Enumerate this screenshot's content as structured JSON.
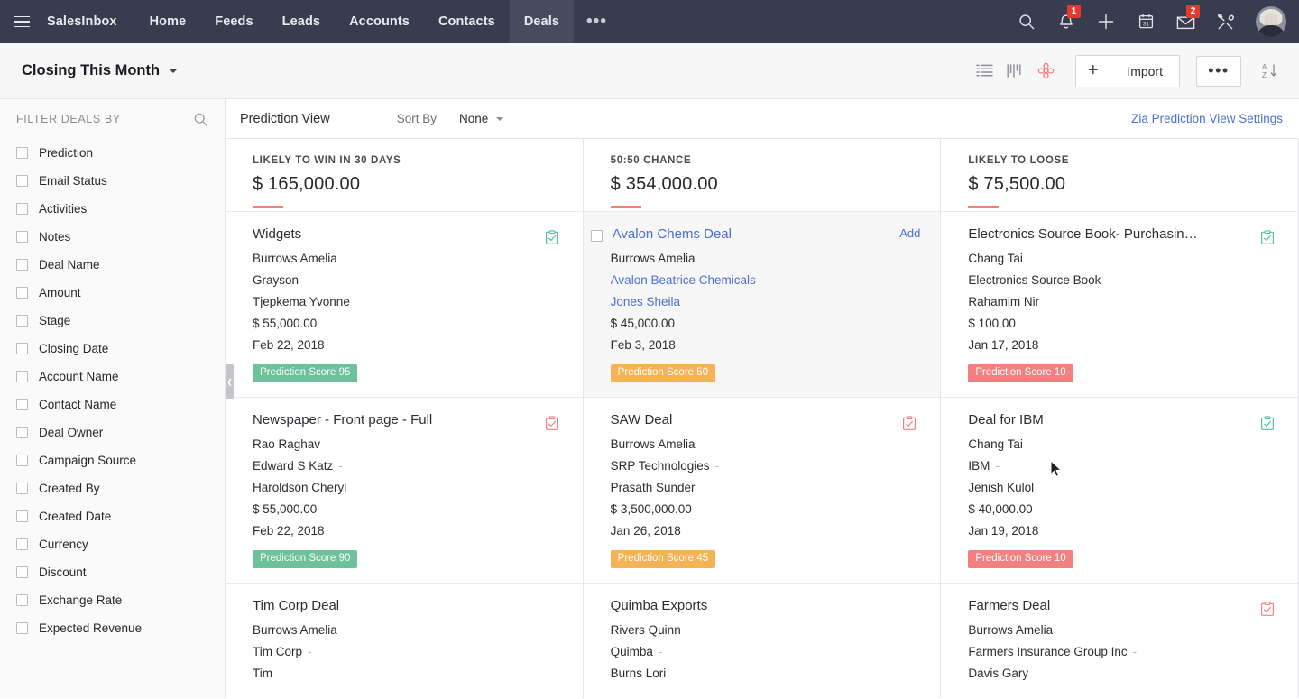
{
  "topnav": {
    "menu_icon": "hamburger-icon",
    "tabs": [
      {
        "label": "SalesInbox",
        "active": false
      },
      {
        "label": "Home",
        "active": false
      },
      {
        "label": "Feeds",
        "active": false
      },
      {
        "label": "Leads",
        "active": false
      },
      {
        "label": "Accounts",
        "active": false
      },
      {
        "label": "Contacts",
        "active": false
      },
      {
        "label": "Deals",
        "active": true
      }
    ],
    "more_label": "•••",
    "icons": [
      {
        "name": "search-icon",
        "badge": ""
      },
      {
        "name": "notifications-bell-icon",
        "badge": "1"
      },
      {
        "name": "add-plus-icon",
        "badge": ""
      },
      {
        "name": "calendar-icon",
        "badge": "",
        "day": "31"
      },
      {
        "name": "mail-envelope-icon",
        "badge": "2"
      },
      {
        "name": "setup-tools-icon",
        "badge": ""
      }
    ],
    "avatar_name": "user-avatar",
    "background": "#383c4e",
    "active_tab_background": "#474b5e",
    "badge_color": "#e13b2f"
  },
  "toolbar": {
    "view_name": "Closing This Month",
    "list_view_icon": "list-view-icon",
    "kanban_view_icon": "kanban-view-icon",
    "zia_icon": "zia-flower-icon",
    "add_label": "+",
    "import_label": "Import",
    "more_label": "•••",
    "sort_icon": "sort-az-descending-icon"
  },
  "sidebar": {
    "title": "FILTER DEALS BY",
    "search_icon": "search-icon",
    "items": [
      {
        "label": "Prediction",
        "checked": false
      },
      {
        "label": "Email Status",
        "checked": false
      },
      {
        "label": "Activities",
        "checked": false
      },
      {
        "label": "Notes",
        "checked": false
      },
      {
        "label": "Deal Name",
        "checked": false
      },
      {
        "label": "Amount",
        "checked": false
      },
      {
        "label": "Stage",
        "checked": false
      },
      {
        "label": "Closing Date",
        "checked": false
      },
      {
        "label": "Account Name",
        "checked": false
      },
      {
        "label": "Contact Name",
        "checked": false
      },
      {
        "label": "Deal Owner",
        "checked": false
      },
      {
        "label": "Campaign Source",
        "checked": false
      },
      {
        "label": "Created By",
        "checked": false
      },
      {
        "label": "Created Date",
        "checked": false
      },
      {
        "label": "Currency",
        "checked": false
      },
      {
        "label": "Discount",
        "checked": false
      },
      {
        "label": "Exchange Rate",
        "checked": false
      },
      {
        "label": "Expected Revenue",
        "checked": false
      }
    ]
  },
  "board_header": {
    "view_label": "Prediction View",
    "sort_by_label": "Sort By",
    "sort_by_value": "None",
    "settings_link": "Zia Prediction View Settings",
    "link_color": "#4a6fd1"
  },
  "columns": [
    {
      "name": "likely-to-win-column",
      "label": "LIKELY TO WIN IN 30 DAYS",
      "amount": "$ 165,000.00",
      "cards": [
        {
          "title": "Widgets",
          "owner": "Burrows Amelia",
          "account": "Grayson",
          "contact": "Tjepkema Yvonne",
          "amount": "$ 55,000.00",
          "date": "Feb 22, 2018",
          "score": "Prediction Score 95",
          "score_tone": "green",
          "task_icon": "task-clipboard-icon",
          "task_tone": "green",
          "hover": false,
          "show_add": false,
          "partial": false
        },
        {
          "title": "Newspaper - Front page - Full",
          "owner": "Rao Raghav",
          "account": "Edward S Katz",
          "contact": "Haroldson Cheryl",
          "amount": "$ 55,000.00",
          "date": "Feb 22, 2018",
          "score": "Prediction Score 90",
          "score_tone": "green",
          "task_icon": "task-clipboard-icon",
          "task_tone": "red",
          "hover": false,
          "show_add": false,
          "partial": false
        },
        {
          "title": "Tim Corp Deal",
          "owner": "Burrows Amelia",
          "account": "Tim Corp",
          "contact": "Tim",
          "amount": "",
          "date": "",
          "score": "",
          "score_tone": "",
          "task_icon": "",
          "task_tone": "",
          "hover": false,
          "show_add": false,
          "partial": true
        }
      ]
    },
    {
      "name": "fifty-fifty-chance-column",
      "label": "50:50 CHANCE",
      "amount": "$ 354,000.00",
      "cards": [
        {
          "title": "Avalon Chems Deal",
          "owner": "Burrows Amelia",
          "account": "Avalon Beatrice Chemicals",
          "contact": "Jones Sheila",
          "amount": "$ 45,000.00",
          "date": "Feb 3, 2018",
          "score": "Prediction Score 50",
          "score_tone": "orange",
          "task_icon": "",
          "task_tone": "",
          "hover": true,
          "show_add": true,
          "add_label": "Add",
          "partial": false
        },
        {
          "title": "SAW Deal",
          "owner": "Burrows Amelia",
          "account": "SRP Technologies",
          "contact": "Prasath Sunder",
          "amount": "$ 3,500,000.00",
          "date": "Jan 26, 2018",
          "score": "Prediction Score 45",
          "score_tone": "orange",
          "task_icon": "task-clipboard-icon",
          "task_tone": "red",
          "hover": false,
          "show_add": false,
          "partial": false
        },
        {
          "title": "Quimba Exports",
          "owner": "Rivers Quinn",
          "account": "Quimba",
          "contact": "Burns Lori",
          "amount": "",
          "date": "",
          "score": "",
          "score_tone": "",
          "task_icon": "",
          "task_tone": "",
          "hover": false,
          "show_add": false,
          "partial": true
        }
      ]
    },
    {
      "name": "likely-to-loose-column",
      "label": "LIKELY TO LOOSE",
      "amount": "$ 75,500.00",
      "cards": [
        {
          "title": "Electronics Source Book- Purchasin…",
          "owner": "Chang Tai",
          "account": "Electronics Source Book",
          "contact": "Rahamim Nir",
          "amount": "$ 100.00",
          "date": "Jan 17, 2018",
          "score": "Prediction Score 10",
          "score_tone": "red",
          "task_icon": "task-clipboard-icon",
          "task_tone": "green",
          "hover": false,
          "show_add": false,
          "partial": false
        },
        {
          "title": "Deal for IBM",
          "owner": "Chang Tai",
          "account": "IBM",
          "contact": "Jenish Kulol",
          "amount": "$ 40,000.00",
          "date": "Jan 19, 2018",
          "score": "Prediction Score 10",
          "score_tone": "red",
          "task_icon": "task-clipboard-icon",
          "task_tone": "green",
          "hover": false,
          "show_add": false,
          "partial": false
        },
        {
          "title": "Farmers Deal",
          "owner": "Burrows Amelia",
          "account": "Farmers Insurance Group Inc",
          "contact": "Davis Gary",
          "amount": "",
          "date": "",
          "score": "",
          "score_tone": "",
          "task_icon": "task-clipboard-icon",
          "task_tone": "red",
          "hover": false,
          "show_add": false,
          "partial": true
        }
      ]
    }
  ],
  "collapse_handle": {
    "name": "sidebar-collapse-handle",
    "glyph": "❮"
  },
  "accent_colors": {
    "rule": "#f58279",
    "green": "#6cc39b",
    "orange": "#f5b356",
    "red": "#f38080",
    "link": "#4a6fd1"
  }
}
